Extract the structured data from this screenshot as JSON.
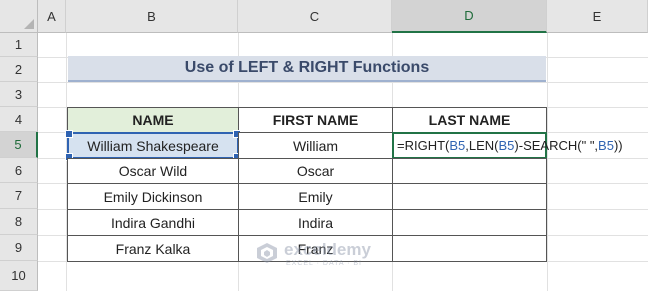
{
  "columns": [
    "A",
    "B",
    "C",
    "D",
    "E"
  ],
  "rows": [
    "1",
    "2",
    "3",
    "4",
    "5",
    "6",
    "7",
    "8",
    "9",
    "10"
  ],
  "active_column": "D",
  "active_row": "5",
  "title": "Use of LEFT & RIGHT Functions",
  "table": {
    "headers": [
      "NAME",
      "FIRST NAME",
      "LAST NAME"
    ],
    "rows": [
      {
        "name": "William Shakespeare",
        "first": "William"
      },
      {
        "name": "Oscar Wild",
        "first": "Oscar"
      },
      {
        "name": "Emily Dickinson",
        "first": "Emily"
      },
      {
        "name": "Indira Gandhi",
        "first": "Indira"
      },
      {
        "name": "Franz Kalka",
        "first": "Franz"
      }
    ]
  },
  "formula": {
    "p1": "=RIGHT(",
    "r1": "B5",
    "p2": ",LEN(",
    "r2": "B5",
    "p3": ")-SEARCH(\" \",",
    "r3": "B5",
    "p4": "))"
  },
  "watermark": {
    "name": "exceldemy",
    "tagline": "EXCEL · DATA · BI",
    "icon": "exceldemy-logo-icon"
  },
  "colors": {
    "title_bg": "#d9dfe9",
    "name_header_bg": "#e2efda",
    "selection": "#2f63b2",
    "edit_border": "#217346"
  }
}
